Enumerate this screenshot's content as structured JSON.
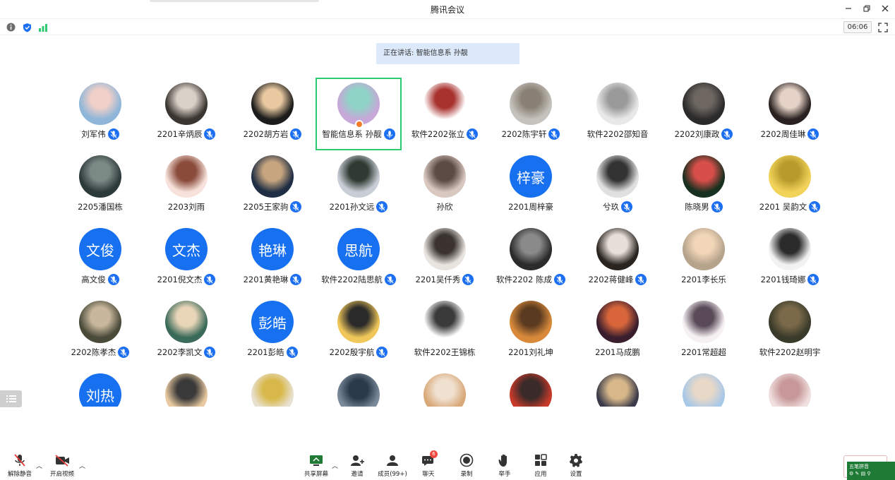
{
  "window": {
    "title": "腾讯会议"
  },
  "status": {
    "timer": "06:06"
  },
  "banner": {
    "text": "正在讲话: 智能信息系 孙靓"
  },
  "participants": [
    {
      "name": "刘军伟",
      "mic": "muted",
      "avatar_colors": [
        "#8fb6d9",
        "#f0d0c8"
      ]
    },
    {
      "name": "2201辛炳辰",
      "mic": "muted",
      "avatar_colors": [
        "#3a3530",
        "#d9d1c8"
      ]
    },
    {
      "name": "2202胡方岩",
      "mic": "muted",
      "avatar_colors": [
        "#1c1c1c",
        "#e8c9a0"
      ]
    },
    {
      "name": "智能信息系 孙靓",
      "mic": "on",
      "host": true,
      "active": true,
      "avatar_colors": [
        "#c7a8d8",
        "#8fd3c7"
      ]
    },
    {
      "name": "软件2202张立",
      "mic": "muted",
      "avatar_colors": [
        "#ffffff",
        "#a8322e"
      ]
    },
    {
      "name": "2202陈宇轩",
      "mic": "muted",
      "avatar_colors": [
        "#c5c3bd",
        "#8a8174"
      ]
    },
    {
      "name": "软件2202邵知音",
      "mic": "none",
      "avatar_colors": [
        "#e8e8e8",
        "#9a9a9a"
      ]
    },
    {
      "name": "2202刘康政",
      "mic": "muted",
      "avatar_colors": [
        "#2b2b2b",
        "#6d6760"
      ]
    },
    {
      "name": "2202周佳琳",
      "mic": "muted",
      "avatar_colors": [
        "#2a2220",
        "#e6d3c8"
      ]
    },
    {
      "name": "2205潘国栋",
      "mic": "none",
      "avatar_colors": [
        "#2d3a3a",
        "#7c8a86"
      ]
    },
    {
      "name": "2203刘雨",
      "mic": "none",
      "avatar_colors": [
        "#f7e3dc",
        "#8a4b3b"
      ]
    },
    {
      "name": "2205王家驹",
      "mic": "muted",
      "avatar_colors": [
        "#1f2e44",
        "#c7a57f"
      ]
    },
    {
      "name": "2201孙文远",
      "mic": "muted",
      "avatar_colors": [
        "#c9ced6",
        "#2e3a32"
      ]
    },
    {
      "name": "孙欣",
      "mic": "none",
      "avatar_colors": [
        "#d8c8c0",
        "#5c4a44"
      ]
    },
    {
      "name": "2201周梓豪",
      "mic": "none",
      "avatar_text": "梓豪"
    },
    {
      "name": "兮玖",
      "mic": "muted",
      "avatar_colors": [
        "#e0e0e0",
        "#333333"
      ]
    },
    {
      "name": "陈晓男",
      "mic": "muted",
      "avatar_colors": [
        "#18301f",
        "#d84f4a"
      ]
    },
    {
      "name": "2201 吴韵文",
      "mic": "muted",
      "avatar_colors": [
        "#f1d35a",
        "#b89a2c"
      ]
    },
    {
      "name": "高文俊",
      "mic": "muted",
      "avatar_text": "文俊"
    },
    {
      "name": "2201倪文杰",
      "mic": "muted",
      "avatar_text": "文杰"
    },
    {
      "name": "2201黄艳琳",
      "mic": "muted",
      "avatar_text": "艳琳"
    },
    {
      "name": "软件2202陆思航",
      "mic": "muted",
      "avatar_text": "思航"
    },
    {
      "name": "2201吴仟秀",
      "mic": "muted",
      "avatar_colors": [
        "#e8e4e0",
        "#3a3330"
      ]
    },
    {
      "name": "软件2202 陈成",
      "mic": "muted",
      "avatar_colors": [
        "#2b2b2b",
        "#8a8a8a"
      ]
    },
    {
      "name": "2202蒋健峰",
      "mic": "muted",
      "avatar_colors": [
        "#2a2420",
        "#e8e0d8"
      ]
    },
    {
      "name": "2201李长乐",
      "mic": "none",
      "avatar_colors": [
        "#b5a38c",
        "#f2d6b8"
      ]
    },
    {
      "name": "2201钱琦娜",
      "mic": "muted",
      "avatar_colors": [
        "#f2f2f2",
        "#2b2b2b"
      ]
    },
    {
      "name": "2202陈孝杰",
      "mic": "muted",
      "avatar_colors": [
        "#4a4a3a",
        "#c8b79c"
      ]
    },
    {
      "name": "2202李凯文",
      "mic": "muted",
      "avatar_colors": [
        "#3a6b5a",
        "#e9d5b8"
      ]
    },
    {
      "name": "2201彭皓",
      "mic": "muted",
      "avatar_text": "彭皓"
    },
    {
      "name": "2202殷宇航",
      "mic": "muted",
      "avatar_colors": [
        "#f0c75a",
        "#2a2a2a"
      ]
    },
    {
      "name": "软件2202王锦栋",
      "mic": "none",
      "avatar_colors": [
        "#ffffff",
        "#3a3a3a"
      ]
    },
    {
      "name": "2201刘礼坤",
      "mic": "none",
      "avatar_colors": [
        "#d88a3a",
        "#5a3a20"
      ]
    },
    {
      "name": "2201马成鹏",
      "mic": "none",
      "avatar_colors": [
        "#3a1e2e",
        "#d8663a"
      ]
    },
    {
      "name": "2201常超超",
      "mic": "none",
      "avatar_colors": [
        "#f5f0f2",
        "#5a4a58"
      ]
    },
    {
      "name": "软件2202赵明宇",
      "mic": "none",
      "avatar_colors": [
        "#3a3a2a",
        "#7a6a4a"
      ]
    },
    {
      "name": "",
      "mic": "none",
      "avatar_text": "刘热"
    },
    {
      "name": "",
      "mic": "none",
      "avatar_colors": [
        "#e8c9a0",
        "#3a3a3a"
      ]
    },
    {
      "name": "",
      "mic": "none",
      "avatar_colors": [
        "#e8e0d0",
        "#d8b84a"
      ]
    },
    {
      "name": "",
      "mic": "none",
      "avatar_colors": [
        "#7a8a9a",
        "#2a3a4a"
      ]
    },
    {
      "name": "",
      "mic": "none",
      "avatar_colors": [
        "#d8a878",
        "#f0e0d0"
      ]
    },
    {
      "name": "",
      "mic": "none",
      "avatar_colors": [
        "#c83a2a",
        "#3a2a2a"
      ]
    },
    {
      "name": "",
      "mic": "none",
      "avatar_colors": [
        "#3a3a4a",
        "#d8b88a"
      ]
    },
    {
      "name": "",
      "mic": "none",
      "avatar_colors": [
        "#a8c8e8",
        "#e8d8c8"
      ]
    },
    {
      "name": "",
      "mic": "none",
      "avatar_colors": [
        "#f0e0e0",
        "#c89898"
      ]
    }
  ],
  "toolbar": {
    "unmute": "解除静音",
    "start_video": "开启视频",
    "share_screen": "共享屏幕",
    "invite": "邀请",
    "members": "成员(99+)",
    "chat": "聊天",
    "chat_badge": "6",
    "record": "录制",
    "raise_hand": "举手",
    "apps": "应用",
    "settings": "设置"
  },
  "ime": {
    "label": "五笔拼音"
  },
  "colors": {
    "accent": "#1d6ff2",
    "active_border": "#2fcb73",
    "banner_bg": "#dce9fb"
  }
}
